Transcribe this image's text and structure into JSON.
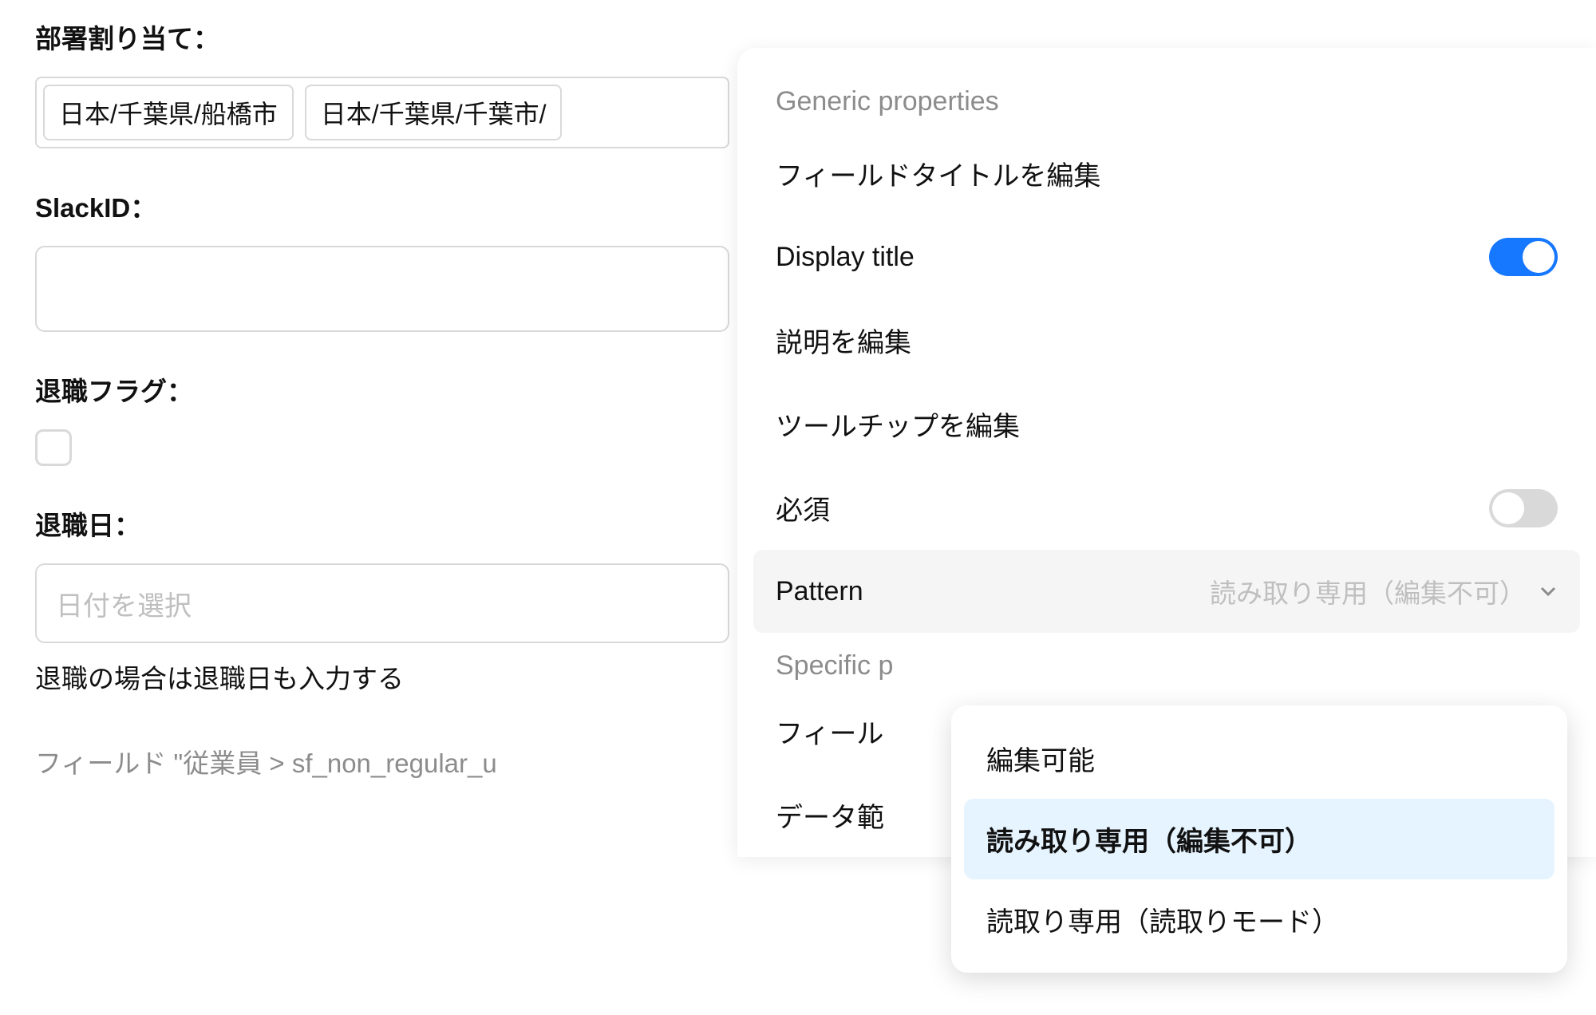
{
  "left": {
    "department": {
      "label": "部署割り当て：",
      "tags": [
        "日本/千葉県/船橋市",
        "日本/千葉県/千葉市/"
      ]
    },
    "slackId": {
      "label": "SlackID："
    },
    "retiredFlag": {
      "label": "退職フラグ："
    },
    "retiredDate": {
      "label": "退職日：",
      "placeholder": "日付を選択",
      "help": "退職の場合は退職日も入力する"
    },
    "fieldHint": "フィールド \"従業員 > sf_non_regular_u"
  },
  "panel": {
    "genericHeader": "Generic properties",
    "editFieldTitle": "フィールドタイトルを編集",
    "displayTitle": "Display title",
    "editDescription": "説明を編集",
    "editTooltip": "ツールチップを編集",
    "required": "必須",
    "pattern": {
      "label": "Pattern",
      "value": "読み取り専用（編集不可）"
    },
    "specificHeader": "Specific p",
    "fieldRow": "フィール",
    "dataRangeRow": "データ範"
  },
  "dropdown": {
    "options": [
      "編集可能",
      "読み取り専用（編集不可）",
      "読取り専用（読取りモード）"
    ],
    "selectedIndex": 1
  }
}
